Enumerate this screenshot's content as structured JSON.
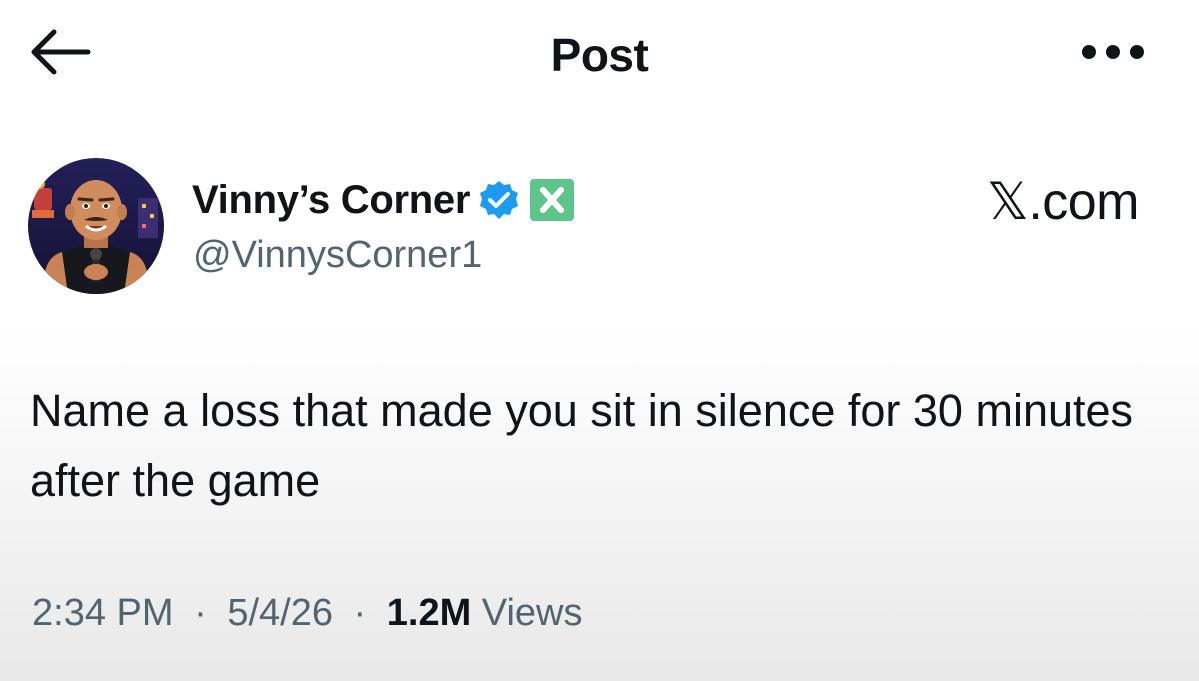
{
  "header": {
    "title": "Post",
    "back_icon": "arrow-left-icon",
    "more_icon": "more-horizontal-icon"
  },
  "author": {
    "display_name": "Vinny’s Corner",
    "handle": "@VinnysCorner1",
    "verified_icon": "verified-badge-icon",
    "verified_color": "#1d9bf0",
    "affiliate_icon": "x-badge-icon",
    "affiliate_color": "#5fc48a",
    "avatar_icon": "cartoon-man-avatar"
  },
  "brand": {
    "label": "𝕏.com"
  },
  "post": {
    "text": "Name a loss that made you sit in silence for 30 minutes after the game"
  },
  "meta": {
    "time": "2:34 PM",
    "separator": "·",
    "date": "5/4/26",
    "views_count": "1.2M",
    "views_label": "Views"
  },
  "colors": {
    "text_primary": "#0f1419",
    "text_secondary": "#536471"
  }
}
